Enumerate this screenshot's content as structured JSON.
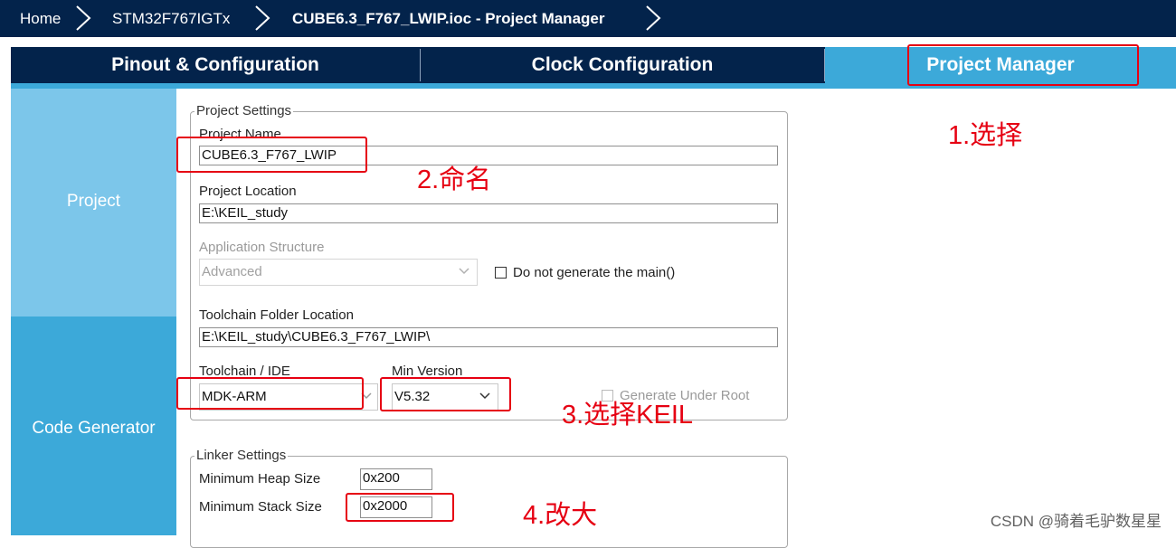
{
  "breadcrumb": {
    "home": "Home",
    "chip": "STM32F767IGTx",
    "current": "CUBE6.3_F767_LWIP.ioc - Project Manager"
  },
  "tabs": [
    {
      "label": "Pinout & Configuration"
    },
    {
      "label": "Clock Configuration"
    },
    {
      "label": "Project Manager",
      "active": true
    }
  ],
  "sidebar": {
    "items": [
      {
        "label": "Project",
        "selected": true
      },
      {
        "label": "Code Generator"
      }
    ]
  },
  "project_settings": {
    "legend": "Project Settings",
    "project_name_label": "Project Name",
    "project_name_value": "CUBE6.3_F767_LWIP",
    "project_location_label": "Project Location",
    "project_location_value": "E:\\KEIL_study",
    "app_structure_label": "Application Structure",
    "app_structure_value": "Advanced",
    "do_not_generate_main_label": "Do not generate the main()",
    "toolchain_folder_label": "Toolchain Folder Location",
    "toolchain_folder_value": "E:\\KEIL_study\\CUBE6.3_F767_LWIP\\",
    "toolchain_ide_label": "Toolchain / IDE",
    "toolchain_ide_value": "MDK-ARM",
    "min_version_label": "Min Version",
    "min_version_value": "V5.32",
    "generate_under_root_label": "Generate Under Root"
  },
  "linker_settings": {
    "legend": "Linker Settings",
    "heap_label": "Minimum Heap Size",
    "heap_value": "0x200",
    "stack_label": "Minimum Stack Size",
    "stack_value": "0x2000"
  },
  "annotations": {
    "step1": "1.选择",
    "step2": "2.命名",
    "step3": "3.选择KEIL",
    "step4": "4.改大"
  },
  "watermark": "CSDN @骑着毛驴数星星",
  "colors": {
    "navy": "#03234b",
    "accent_blue": "#3ca9d9",
    "light_blue": "#7cc6ea",
    "annotation_red": "#e60012"
  }
}
